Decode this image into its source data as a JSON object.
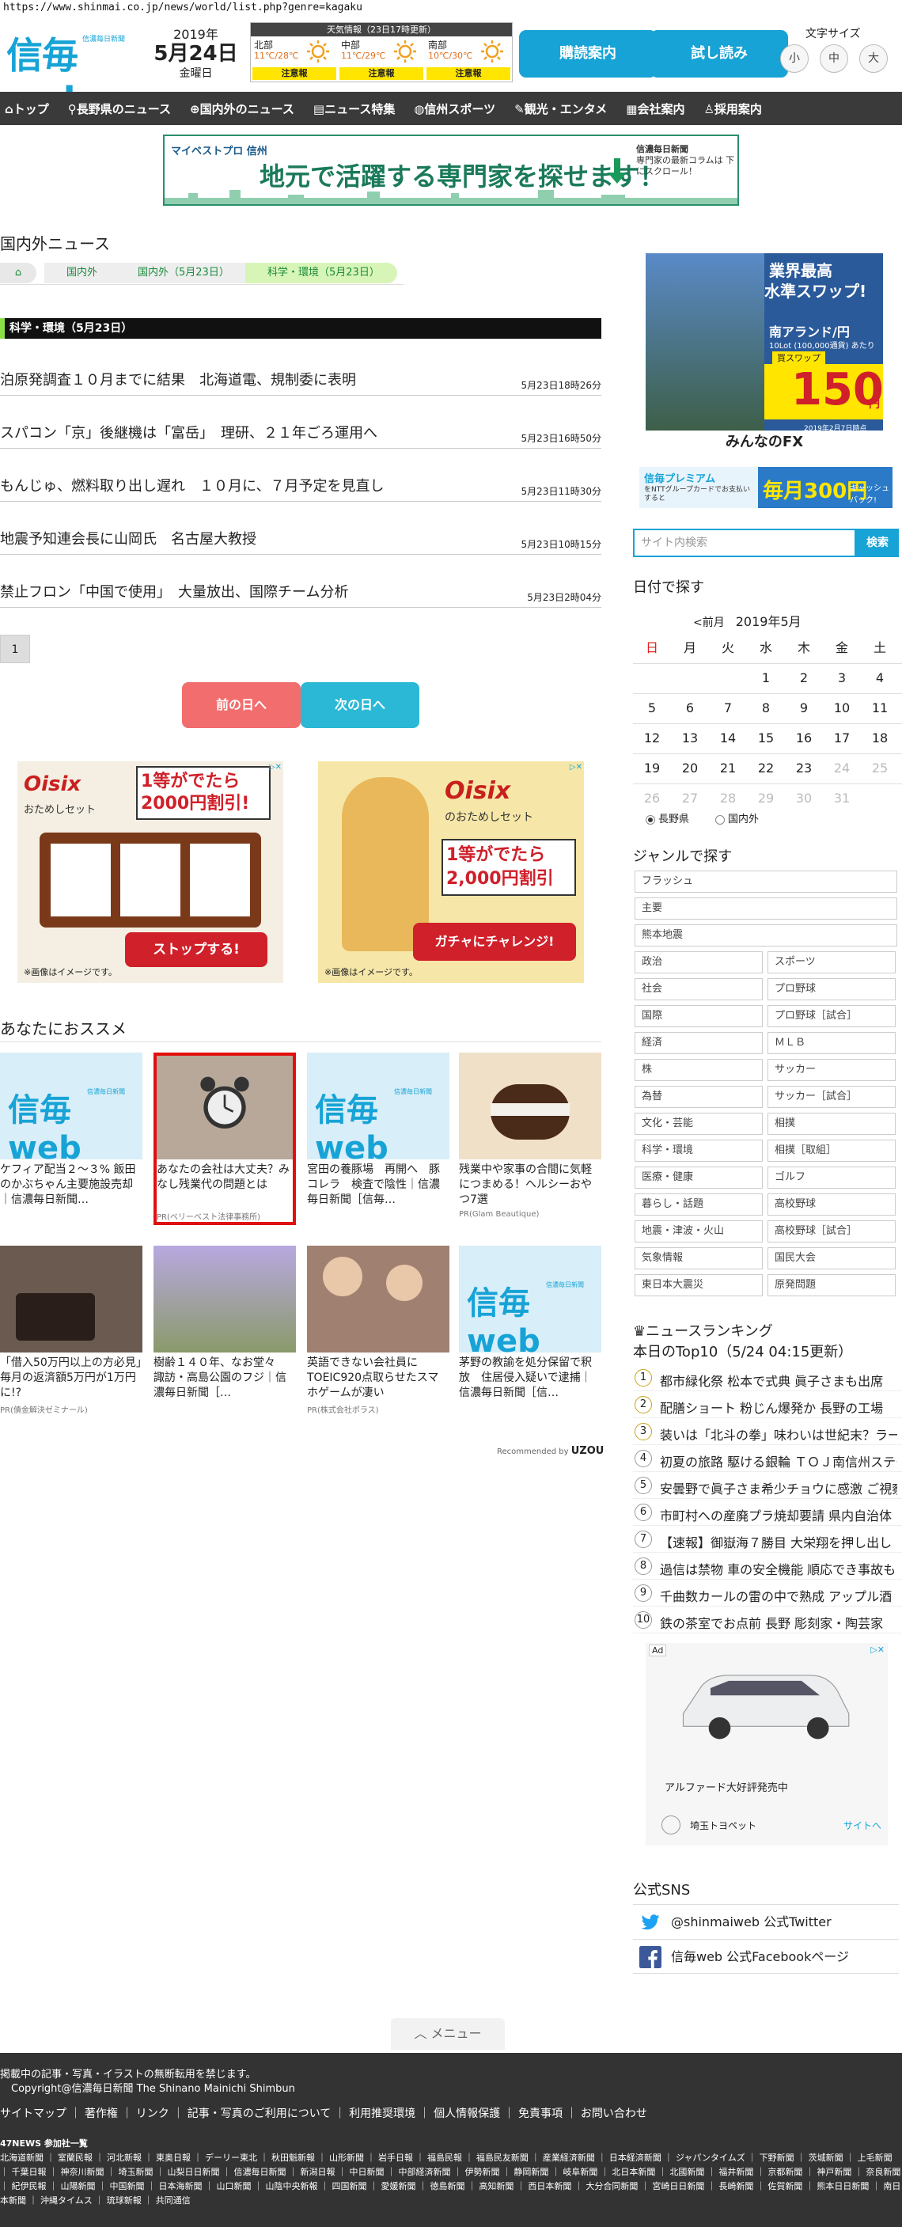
{
  "url": "https://www.shinmai.co.jp/news/world/list.php?genre=kagaku",
  "header": {
    "logo_small": "信濃毎日新聞",
    "logo": "信毎web",
    "year": "2019年",
    "md": "5月24日",
    "wday": "金曜日",
    "weather": {
      "title": "天気情報（23日17時更新）",
      "cells": [
        {
          "name": "北部",
          "temp": "11℃/28℃",
          "alert": "注意報"
        },
        {
          "name": "中部",
          "temp": "11℃/29℃",
          "alert": "注意報"
        },
        {
          "name": "南部",
          "temp": "10℃/30℃",
          "alert": "注意報"
        }
      ]
    },
    "btn1": "購読案内",
    "btn2": "試し読み",
    "font_label": "文字サイズ",
    "font_sizes": [
      "小",
      "中",
      "大"
    ]
  },
  "nav": [
    "トップ",
    "長野県のニュース",
    "国内外のニュース",
    "ニュース特集",
    "信州スポーツ",
    "観光・エンタメ",
    "会社案内",
    "採用案内"
  ],
  "nav_icons": [
    "house-icon",
    "pin-icon",
    "globe-icon",
    "document-icon",
    "sports-icon",
    "pen-icon",
    "building-icon",
    "person-icon"
  ],
  "banner": {
    "left": "マイベストプロ 信州",
    "text": "地元で活躍する専門家を探せます！",
    "right1": "信濃毎日新聞",
    "right2": "専門家の最新コラムは 下にスクロール！"
  },
  "main": {
    "title": "国内外ニュース",
    "crumbs": [
      "国内外",
      "国内外（5月23日）",
      "科学・環境（5月23日）"
    ],
    "section": "科学・環境（5月23日）",
    "news": [
      {
        "title": "泊原発調査１０月までに結果　北海道電、規制委に表明",
        "time": "5月23日18時26分"
      },
      {
        "title": "スパコン「京」後継機は「富岳」　理研、２１年ごろ運用へ",
        "time": "5月23日16時50分"
      },
      {
        "title": "もんじゅ、燃料取り出し遅れ　１０月に、７月予定を見直し",
        "time": "5月23日11時30分"
      },
      {
        "title": "地震予知連会長に山岡氏　名古屋大教授",
        "time": "5月23日10時15分"
      },
      {
        "title": "禁止フロン「中国で使用」　大量放出、国際チーム分析",
        "time": "5月23日2時04分"
      }
    ],
    "page": "1",
    "prev": "前の日へ",
    "next": "次の日へ"
  },
  "ads": [
    {
      "brand": "Oisix",
      "sub": "おためしセット",
      "promo": "1等がでたら 2000円割引!",
      "cta": "ストップする!",
      "note": "※画像はイメージです。"
    },
    {
      "brand": "Oisix",
      "sub": "のおためしセット",
      "promo": "1等がでたら 2,000円割引",
      "cta": "ガチャにチャレンジ!",
      "note": "※画像はイメージです。"
    }
  ],
  "rec": {
    "title": "あなたにおススメ",
    "by": "Recommended by",
    "byBrand": "UZOU",
    "logo": "信毎web",
    "logoSmall": "信濃毎日新聞",
    "cards": [
      {
        "text": "ケフィア配当２～３% 飯田のかぶちゃん主要施設売却｜信濃毎日新聞…",
        "pr": ""
      },
      {
        "text": "あなたの会社は大丈夫？みなし残業代の問題とは",
        "pr": "PR(ベリーベスト法律事務所)"
      },
      {
        "text": "宮田の養豚場　再開へ　豚コレラ　検査で陰性｜信濃毎日新聞［信毎…",
        "pr": ""
      },
      {
        "text": "残業中や家事の合間に気軽につまめる！ヘルシーおやつ7選",
        "pr": "PR(Glam Beautique)"
      },
      {
        "text": "「借入50万円以上の方必見」毎月の返済額5万円が1万円に!?",
        "pr": "PR(債金解決ゼミナール)"
      },
      {
        "text": "樹齢１４０年、なお堂々　諏訪・高島公園のフジ｜信濃毎日新聞［…",
        "pr": ""
      },
      {
        "text": "英語できない会社員にTOEIC920点取らせたスマホゲームが凄い",
        "pr": "PR(株式会社ポラス)"
      },
      {
        "text": "茅野の教諭を処分保留で釈放　住居侵入疑いで逮捕｜信濃毎日新聞［信…",
        "pr": ""
      }
    ]
  },
  "side": {
    "ad1": {
      "t1": "業界最高",
      "t2": "水準スワップ!",
      "t3": "南アランド/円",
      "t4": "10Lot (100,000通貨) あたり",
      "t5": "買スワップ",
      "t6": "150",
      "t7": "円",
      "t8": "2019年2月7日時点",
      "brand": "みんなのFX"
    },
    "ban2": {
      "t1": "信毎プレミアム",
      "t2": "をNTTグループカードでお支払いすると",
      "t3": "毎月300円",
      "t4": "キャッシュバック!"
    },
    "search_ph": "サイト内検索",
    "search_btn": "検索",
    "date_h": "日付で探す",
    "prev_m": "<前月",
    "month": "2019年5月",
    "wdays": [
      "日",
      "月",
      "火",
      "水",
      "木",
      "金",
      "土"
    ],
    "weeks": [
      [
        "",
        "",
        "",
        "1",
        "2",
        "3",
        "4"
      ],
      [
        "5",
        "6",
        "7",
        "8",
        "9",
        "10",
        "11"
      ],
      [
        "12",
        "13",
        "14",
        "15",
        "16",
        "17",
        "18"
      ],
      [
        "19",
        "20",
        "21",
        "22",
        "23",
        "24",
        "25"
      ],
      [
        "26",
        "27",
        "28",
        "29",
        "30",
        "31",
        ""
      ]
    ],
    "radio": [
      "長野県",
      "国内外"
    ],
    "genre_h": "ジャンルで探す",
    "genres_full": [
      "フラッシュ",
      "主要",
      "熊本地震"
    ],
    "genres": [
      "政治",
      "スポーツ",
      "社会",
      "プロ野球",
      "国際",
      "プロ野球［試合］",
      "経済",
      "ＭＬＢ",
      "株",
      "サッカー",
      "為替",
      "サッカー［試合］",
      "文化・芸能",
      "相撲",
      "科学・環境",
      "相撲［取組］",
      "医療・健康",
      "ゴルフ",
      "暮らし・話題",
      "高校野球",
      "地震・津波・火山",
      "高校野球［試合］",
      "気象情報",
      "国民大会",
      "東日本大震災",
      "原発問題"
    ],
    "rank_h": "ニュースランキング",
    "rank_sub": "本日のTop10（5/24 04:15更新）",
    "ranks": [
      "都市緑化祭 松本で式典 眞子さまも出席",
      "配膳ショート 粉じん爆発か 長野の工場",
      "装いは「北斗の拳」味わいは世紀末？ラーメン",
      "初夏の旅路 駆ける銀輪 ＴＯＪ南信州ステージ",
      "安曇野で眞子さま希少チョウに感激 ご視察",
      "市町村への産廃プラ焼却要請 県内自治体",
      "【速報】御嶽海７勝目 大栄翔を押し出し",
      "過信は禁物 車の安全機能 順応でき事故も",
      "千曲数カールの雷の中で熟成 アップル酒",
      "鉄の茶室でお点前 長野 彫刻家・陶芸家"
    ],
    "ad2": {
      "adtag": "Ad",
      "title": "アルファード大好評発売中",
      "dealer": "埼玉トヨペット",
      "link": "サイトへ"
    },
    "sns_h": "公式SNS",
    "sns": [
      "@shinmaiweb 公式Twitter",
      "信毎web 公式Facebookページ"
    ],
    "menu": "メニュー"
  },
  "footer": {
    "l1": "掲載中の記事・写真・イラストの無断転用を禁じます。",
    "l2": "Copyright@信濃毎日新聞 The Shinano Mainichi Shimbun",
    "links": "サイトマップ ｜ 著作権 ｜ リンク ｜ 記事・写真のご利用について ｜ 利用推奨環境 ｜ 個人情報保護 ｜ 免責事項 ｜ お問い合わせ",
    "n47": "47NEWS 参加社一覧",
    "papers": "北海道新聞 ｜ 室蘭民報 ｜ 河北新報 ｜ 東奥日報 ｜ デーリー東北 ｜ 秋田魁新報 ｜ 山形新聞 ｜ 岩手日報 ｜ 福島民報 ｜ 福島民友新聞 ｜ 産業経済新聞 ｜ 日本経済新聞 ｜ ジャパンタイムズ ｜ 下野新聞 ｜ 茨城新聞 ｜ 上毛新聞 ｜ 千葉日報 ｜ 神奈川新聞 ｜ 埼玉新聞 ｜ 山梨日日新聞 ｜ 信濃毎日新聞 ｜ 新潟日報 ｜ 中日新聞 ｜ 中部経済新聞 ｜ 伊勢新聞 ｜ 静岡新聞 ｜ 岐阜新聞 ｜ 北日本新聞 ｜ 北國新聞 ｜ 福井新聞 ｜ 京都新聞 ｜ 神戸新聞 ｜ 奈良新聞 ｜ 紀伊民報 ｜ 山陽新聞 ｜ 中国新聞 ｜ 日本海新聞 ｜ 山口新聞 ｜ 山陰中央新報 ｜ 四国新聞 ｜ 愛媛新聞 ｜ 徳島新聞 ｜ 高知新聞 ｜ 西日本新聞 ｜ 大分合同新聞 ｜ 宮崎日日新聞 ｜ 長崎新聞 ｜ 佐賀新聞 ｜ 熊本日日新聞 ｜ 南日本新聞 ｜ 沖縄タイムス ｜ 琉球新報 ｜ 共同通信"
  },
  "colors": {
    "accent": "#17a3d6",
    "nav": "#3a3a3a",
    "green": "#8be04a",
    "prev": "#f26d6d",
    "next": "#2bb8d6",
    "alert": "#ffe500"
  }
}
